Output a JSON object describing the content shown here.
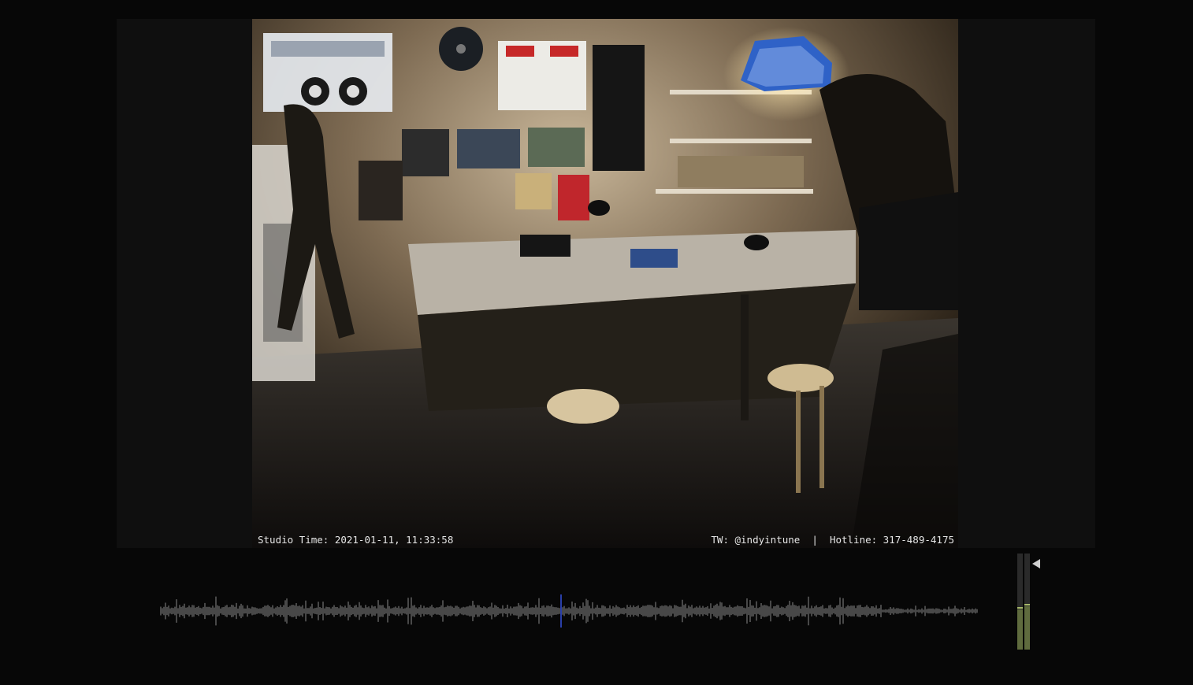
{
  "overlay": {
    "studio_time_label": "Studio Time: 2021-01-11, 11:33:58",
    "social": "TW: @indyintune",
    "separator": "|",
    "hotline": "Hotline: 317-489-4175"
  },
  "video": {
    "description_icon": "studio-webcam-feed-image"
  },
  "audio": {
    "waveform_color": "#8a8a8a",
    "playhead_color": "#2a3fa8",
    "playback_progress": 0.49,
    "meter_level_left": 0.42,
    "meter_level_right": 0.45,
    "volume_icon": "triangle-left-icon"
  },
  "colors": {
    "background": "#070707",
    "panel": "#0f0f0f",
    "overlay_text": "#e6e6e6"
  }
}
